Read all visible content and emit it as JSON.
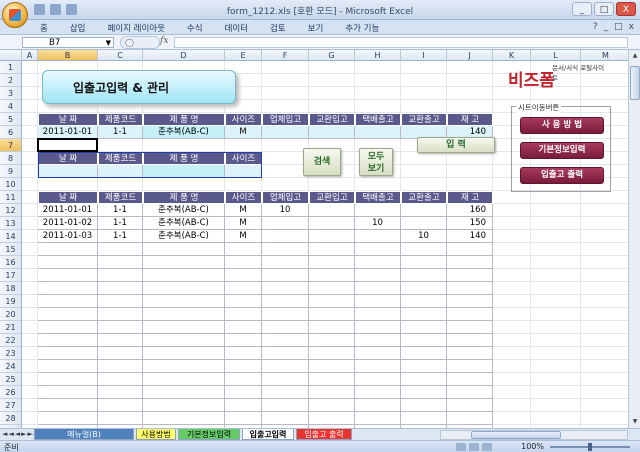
{
  "window": {
    "title": "form_1212.xls  [호환 모드]  -  Microsoft Excel",
    "controls": [
      "_",
      "□",
      "X"
    ]
  },
  "ribbon": {
    "tabs": [
      "홈",
      "삽입",
      "페이지 레이아웃",
      "수식",
      "데이터",
      "검토",
      "보기",
      "추가 기능"
    ],
    "right_controls": [
      "?",
      "_",
      "□",
      "x"
    ]
  },
  "formula_bar": {
    "name_box": "B7",
    "fx": "fx",
    "formula": ""
  },
  "columns": [
    "A",
    "B",
    "C",
    "D",
    "E",
    "F",
    "G",
    "H",
    "I",
    "J",
    "K",
    "L",
    "M",
    "N"
  ],
  "rows": [
    "1",
    "2",
    "3",
    "4",
    "5",
    "6",
    "7",
    "8",
    "9",
    "10",
    "11",
    "12",
    "13",
    "14",
    "15",
    "16",
    "17",
    "18",
    "19",
    "20",
    "21",
    "22",
    "23",
    "24",
    "25",
    "26",
    "27",
    "28",
    "29"
  ],
  "sheet_title": "입출고입력 & 관리",
  "input_table": {
    "headers": [
      "날 짜",
      "제품코드",
      "제 품 명",
      "사이즈",
      "업체입고",
      "교환입고",
      "택배출고",
      "교환출고",
      "재 고"
    ],
    "row": [
      "2011-01-01",
      "1-1",
      "춘추복(AB-C)",
      "M",
      "",
      "",
      "",
      "",
      "140"
    ]
  },
  "search_table": {
    "headers": [
      "날 짜",
      "제품코드",
      "제 품 명",
      "사이즈"
    ],
    "row": [
      "",
      "",
      "",
      ""
    ]
  },
  "buttons": {
    "search": "검색",
    "show_all": "모두\n보기",
    "input": "입  력"
  },
  "data_table": {
    "headers": [
      "날 짜",
      "제품코드",
      "제 품 명",
      "사이즈",
      "업체입고",
      "교환입고",
      "택배출고",
      "교환출고",
      "재 고"
    ],
    "rows": [
      [
        "2011-01-01",
        "1-1",
        "춘추복(AB-C)",
        "M",
        "10",
        "",
        "",
        "",
        "160"
      ],
      [
        "2011-01-02",
        "1-1",
        "춘추복(AB-C)",
        "M",
        "",
        "",
        "10",
        "",
        "150"
      ],
      [
        "2011-01-03",
        "1-1",
        "춘추복(AB-C)",
        "M",
        "",
        "",
        "",
        "10",
        "140"
      ]
    ]
  },
  "brand": {
    "name": "비즈폼",
    "tagline": "문서/서식 포털사이트"
  },
  "site_nav": {
    "label": "시트이동버튼",
    "buttons": [
      "사 용 방 법",
      "기본정보입력",
      "입출고 출력"
    ]
  },
  "sheet_tabs": [
    {
      "label": "메뉴얼(B)",
      "color": "#4f81bd"
    },
    {
      "label": "사용방법",
      "color": "#ffff66"
    },
    {
      "label": "기본정보입력",
      "color": "#66cc66"
    },
    {
      "label": "입출고입력",
      "color": "#ffffff"
    },
    {
      "label": "입출고 출력",
      "color": "#e33"
    }
  ],
  "status": {
    "ready": "준비",
    "zoom": "100%"
  }
}
